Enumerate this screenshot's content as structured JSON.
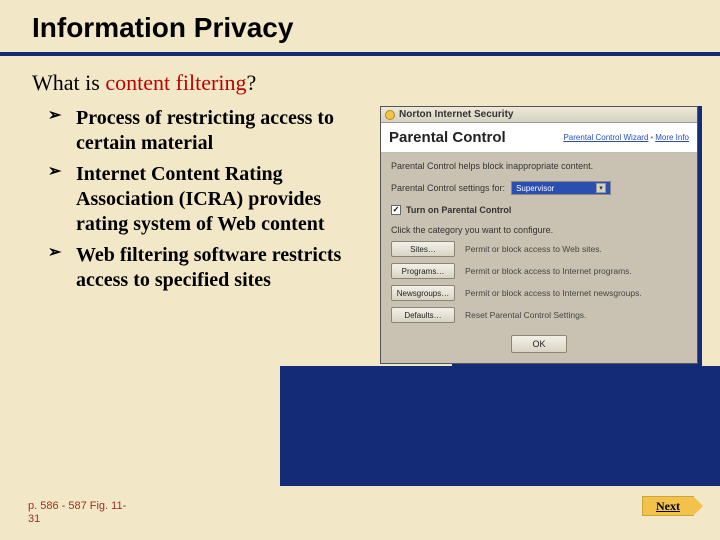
{
  "title": "Information Privacy",
  "subtitle_prefix": "What is ",
  "subtitle_accent": "content filtering",
  "subtitle_suffix": "?",
  "bullets": [
    "Process of restricting access to certain material",
    "Internet Content Rating Association (ICRA) provides rating system of Web content",
    "Web filtering software restricts access to specified sites"
  ],
  "window": {
    "titlebar": "Norton Internet Security",
    "heading": "Parental Control",
    "link1": "Parental Control Wizard",
    "link2": "More Info",
    "description": "Parental Control helps block inappropriate content.",
    "settings_label": "Parental Control settings for:",
    "dropdown_value": "Supervisor",
    "toggle_label": "Turn on Parental Control",
    "category_intro": "Click the category you want to configure.",
    "categories": [
      {
        "btn": "Sites…",
        "desc": "Permit or block access to Web sites."
      },
      {
        "btn": "Programs…",
        "desc": "Permit or block access to Internet programs."
      },
      {
        "btn": "Newsgroups…",
        "desc": "Permit or block access to Internet newsgroups."
      },
      {
        "btn": "Defaults…",
        "desc": "Reset Parental Control Settings."
      }
    ],
    "ok": "OK"
  },
  "footer_ref_line1": "p. 586 - 587 Fig. 11-",
  "footer_ref_line2": "31",
  "next_label": "Next"
}
